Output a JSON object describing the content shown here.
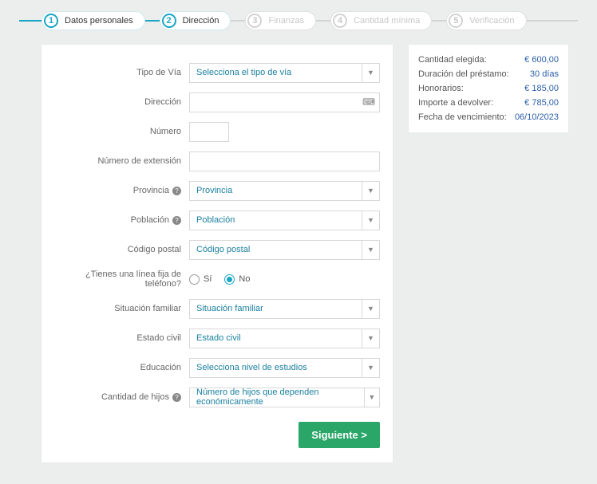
{
  "stepper": {
    "steps": [
      {
        "num": "1",
        "label": "Datos personales",
        "active": true
      },
      {
        "num": "2",
        "label": "Dirección",
        "active": true
      },
      {
        "num": "3",
        "label": "Finanzas",
        "active": false
      },
      {
        "num": "4",
        "label": "Cantidad mínima",
        "active": false
      },
      {
        "num": "5",
        "label": "Verificación",
        "active": false
      }
    ]
  },
  "form": {
    "tipo_via": {
      "label": "Tipo de Vía",
      "placeholder": "Selecciona el tipo de vía"
    },
    "direccion": {
      "label": "Dirección",
      "value": ""
    },
    "numero": {
      "label": "Número",
      "value": ""
    },
    "numero_ext": {
      "label": "Número de extensión",
      "value": ""
    },
    "provincia": {
      "label": "Provincia",
      "placeholder": "Provincia"
    },
    "poblacion": {
      "label": "Población",
      "placeholder": "Población"
    },
    "codigo_postal": {
      "label": "Código postal",
      "placeholder": "Código postal"
    },
    "telefono_fijo": {
      "label": "¿Tienes una línea fija de teléfono?",
      "si": "Sí",
      "no": "No",
      "value": "no"
    },
    "situacion_familiar": {
      "label": "Situación familiar",
      "placeholder": "Situación familiar"
    },
    "estado_civil": {
      "label": "Estado civil",
      "placeholder": "Estado civil"
    },
    "educacion": {
      "label": "Educación",
      "placeholder": "Selecciona nivel de estudios"
    },
    "cantidad_hijos": {
      "label": "Cantidad de hijos",
      "placeholder": "Número de hijos que dependen económicamente"
    },
    "next_button": "Siguiente >"
  },
  "summary": {
    "rows": [
      {
        "label": "Cantidad elegida:",
        "value": "€  600,00"
      },
      {
        "label": "Duración del préstamo:",
        "value": "30 días"
      },
      {
        "label": "Honorarios:",
        "value": "€  185,00"
      },
      {
        "label": "Importe a devolver:",
        "value": "€  785,00"
      },
      {
        "label": "Fecha de vencimiento:",
        "value": "06/10/2023"
      }
    ]
  }
}
